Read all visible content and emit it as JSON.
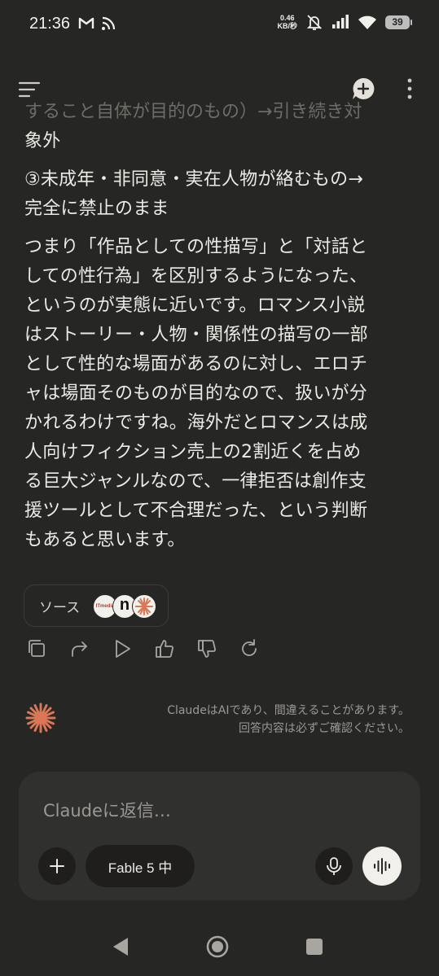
{
  "status_bar": {
    "time": "21:36",
    "net_speed_value": "0.46",
    "net_speed_unit": "KB/秒",
    "battery": "39"
  },
  "chat": {
    "faded_line": "すること自体が目的のもの）→引き続き対",
    "paragraphs": [
      [
        "象外"
      ],
      [
        "③未成年・非同意・実在人物が絡むもの→",
        "完全に禁止のまま"
      ],
      [
        "つまり「作品としての性描写」と「対話と",
        "しての性行為」を区別するようになった、",
        "というのが実態に近いです。ロマンス小説",
        "はストーリー・人物・関係性の描写の一部",
        "として性的な場面があるのに対し、エロチ",
        "ャは場面そのものが目的なので、扱いが分",
        "かれるわけですね。海外だとロマンスは成",
        "人向けフィクション売上の2割近くを占め",
        "る巨大ジャンルなので、一律拒否は創作支",
        "援ツールとして不合理だった、という判断",
        "もあると思います。"
      ]
    ],
    "sources_label": "ソース",
    "source_icon_1_text": "ITmedia",
    "source_icon_2_text": "n"
  },
  "disclaimer": {
    "line1": "ClaudeはAIであり、間違えることがあります。",
    "line2": "回答内容は必ずご確認ください。"
  },
  "composer": {
    "placeholder": "Claudeに返信…",
    "model_label": "Fable 5 中"
  },
  "colors": {
    "background": "#262624",
    "text": "#ECEAE4",
    "accent": "#D97757",
    "composer_bg": "#30302e"
  }
}
